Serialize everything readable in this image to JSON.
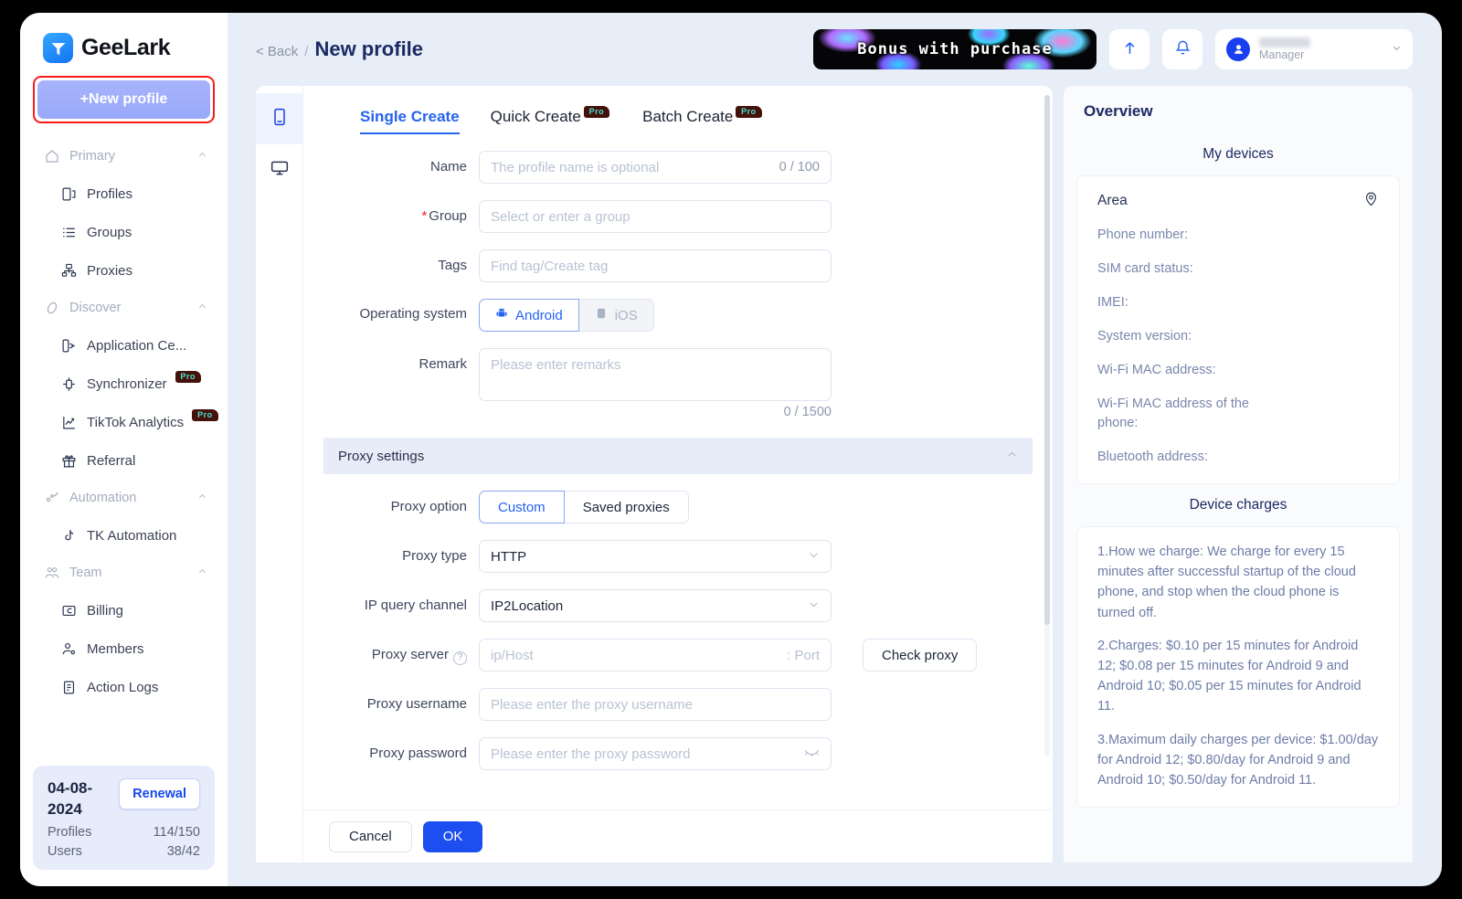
{
  "brand": {
    "name": "GeeLark",
    "logo_icon": "geelark-logo-icon"
  },
  "sidebar": {
    "new_profile_label": "+New profile",
    "groups": [
      {
        "label": "Primary",
        "icon": "home-icon",
        "items": [
          {
            "label": "Profiles",
            "icon": "profiles-icon",
            "pro": false
          },
          {
            "label": "Groups",
            "icon": "groups-list-icon",
            "pro": false
          },
          {
            "label": "Proxies",
            "icon": "proxies-network-icon",
            "pro": false
          }
        ]
      },
      {
        "label": "Discover",
        "icon": "compass-icon",
        "items": [
          {
            "label": "Application Ce...",
            "icon": "application-center-icon",
            "pro": false
          },
          {
            "label": "Synchronizer",
            "icon": "synchronizer-icon",
            "pro": true
          },
          {
            "label": "TikTok Analytics",
            "icon": "analytics-chart-icon",
            "pro": true
          },
          {
            "label": "Referral",
            "icon": "gift-icon",
            "pro": false
          }
        ]
      },
      {
        "label": "Automation",
        "icon": "automation-icon",
        "items": [
          {
            "label": "TK Automation",
            "icon": "tiktok-note-icon",
            "pro": false
          }
        ]
      },
      {
        "label": "Team",
        "icon": "team-people-icon",
        "items": [
          {
            "label": "Billing",
            "icon": "billing-card-icon",
            "pro": false
          },
          {
            "label": "Members",
            "icon": "member-person-icon",
            "pro": false
          },
          {
            "label": "Action Logs",
            "icon": "action-logs-icon",
            "pro": false
          }
        ]
      }
    ],
    "pro_badge_label": "Pro",
    "plan": {
      "date": "04-08-2024",
      "renewal_label": "Renewal",
      "rows": [
        {
          "label": "Profiles",
          "value": "114/150"
        },
        {
          "label": "Users",
          "value": "38/42"
        }
      ]
    }
  },
  "topbar": {
    "back_label": "< Back",
    "separator": "/",
    "title": "New profile",
    "banner_text": "Bonus with purchase",
    "upgrade_icon": "upload-arrow-icon",
    "bell_icon": "bell-notification-icon",
    "avatar_icon": "user-avatar-icon",
    "user_role": "Manager",
    "caret_icon": "chevron-down-icon"
  },
  "vtabs": [
    {
      "icon": "phone-device-icon",
      "active": true
    },
    {
      "icon": "desktop-monitor-icon",
      "active": false
    }
  ],
  "tabs": [
    {
      "label": "Single Create",
      "active": true,
      "pro": false
    },
    {
      "label": "Quick Create",
      "active": false,
      "pro": true
    },
    {
      "label": "Batch Create",
      "active": false,
      "pro": true
    }
  ],
  "pro_badge_label": "Pro",
  "form": {
    "name": {
      "label": "Name",
      "placeholder": "The profile name is optional",
      "counter": "0 / 100",
      "value": ""
    },
    "group": {
      "label": "Group",
      "required": true,
      "placeholder": "Select or enter a group",
      "value": ""
    },
    "tags": {
      "label": "Tags",
      "placeholder": "Find tag/Create tag",
      "value": ""
    },
    "os": {
      "label": "Operating system",
      "options": [
        {
          "label": "Android",
          "icon": "android-robot-icon",
          "active": true
        },
        {
          "label": "iOS",
          "icon": "apple-logo-icon",
          "active": false
        }
      ]
    },
    "remark": {
      "label": "Remark",
      "placeholder": "Please enter remarks",
      "counter": "0 / 1500",
      "value": ""
    }
  },
  "proxy_section": {
    "title": "Proxy settings",
    "collapse_icon": "chevron-up-icon",
    "proxy_option": {
      "label": "Proxy option",
      "options": [
        {
          "label": "Custom",
          "active": true
        },
        {
          "label": "Saved proxies",
          "active": false
        }
      ]
    },
    "proxy_type": {
      "label": "Proxy type",
      "value": "HTTP"
    },
    "ip_query_channel": {
      "label": "IP query channel",
      "value": "IP2Location"
    },
    "proxy_server": {
      "label": "Proxy server",
      "help_icon": "question-mark-icon",
      "host_placeholder": "ip/Host",
      "port_placeholder": ": Port",
      "check_button": "Check proxy"
    },
    "proxy_username": {
      "label": "Proxy username",
      "placeholder": "Please enter the proxy username"
    },
    "proxy_password": {
      "label": "Proxy password",
      "placeholder": "Please enter the proxy password",
      "eye_icon": "eye-off-icon"
    }
  },
  "footer": {
    "cancel_label": "Cancel",
    "ok_label": "OK"
  },
  "overview": {
    "title": "Overview",
    "devices": {
      "section_title": "My devices",
      "area_label": "Area",
      "location_icon": "location-pin-icon",
      "fields": [
        "Phone number:",
        "SIM card status:",
        "IMEI:",
        "System version:",
        "Wi-Fi MAC address:",
        "Wi-Fi MAC address of the phone:",
        "Bluetooth address:"
      ]
    },
    "charges": {
      "section_title": "Device charges",
      "paragraphs": [
        "1.How we charge: We charge for every 15 minutes after successful startup of the cloud phone, and stop when the cloud phone is turned off.",
        "2.Charges: $0.10 per 15 minutes for Android 12; $0.08 per 15 minutes for Android 9 and Android 10; $0.05 per 15 minutes for Android 11.",
        "3.Maximum daily charges per device: $1.00/day for Android 12; $0.80/day for Android 9 and Android 10; $0.50/day for Android 11."
      ]
    }
  },
  "colors": {
    "accent": "#2563f0",
    "primary_button": "#1d4ff0",
    "highlight_border": "#f81b1b",
    "app_bg": "#e8eef8",
    "pro_badge_bg": "#44120a",
    "pro_badge_text": "#49e0cd"
  }
}
